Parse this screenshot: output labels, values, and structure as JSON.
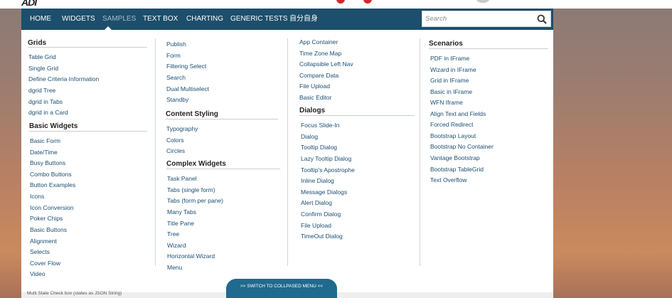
{
  "brand": {
    "logo_text": "ADI",
    "logo_accent": "#c0242a"
  },
  "nav": {
    "items": [
      "HOME",
      "WIDGETS",
      "SAMPLES",
      "TEXT BOX",
      "CHARTING",
      "GENERIC TESTS",
      "自分自身"
    ],
    "active": "SAMPLES"
  },
  "search": {
    "placeholder": "Search",
    "icon": "search-icon"
  },
  "col1": {
    "grids_heading": "Grids",
    "grids": [
      "Table Grid",
      "Single Grid",
      "Define Criteria Information",
      "dgrid Tree",
      "dgrid in Tabs",
      "dgrid in a Card"
    ],
    "basic_heading": "Basic Widgets",
    "basic": [
      "Basic Form",
      "Date/Time",
      "Busy Buttons",
      "Combo Buttons",
      "Button Examples",
      "Icons",
      "Icon Conversion",
      "Poker Chips",
      "Basic Buttons",
      "Alignment",
      "Selects",
      "Cover Flow",
      "Video"
    ]
  },
  "col2": {
    "top": [
      "Publish",
      "Form",
      "Filtering Select",
      "Search",
      "Dual Multiselect",
      "Standby"
    ],
    "content_heading": "Content Styling",
    "content": [
      "Typography",
      "Colors",
      "Circles"
    ],
    "complex_heading": "Complex Widgets",
    "complex": [
      "Task Panel",
      "Tabs (single form)",
      "Tabs (form per pane)",
      "Many Tabs",
      "Title Pane",
      "Tree",
      "Wizard",
      "Horizontal Wizard",
      "Menu"
    ]
  },
  "col3": {
    "top": [
      "App Container",
      "Time Zone Map",
      "Collapsible Left Nav",
      "Compare Data",
      "File Upload",
      "Basic Editor"
    ],
    "dialogs_heading": "Dialogs",
    "dialogs": [
      "Focus Slide-In",
      "Dialog",
      "Tooltip Dialog",
      "Lazy Tooltip Dialog",
      "Tooltip's Apostrophe",
      "Inline Dialog",
      "Message Dialogs",
      "Alert Dialog",
      "Confirm Dialog",
      "File Upload",
      "TimeOut Dialog"
    ]
  },
  "col4": {
    "scenarios_heading": "Scenarios",
    "scenarios": [
      "PDF in IFrame",
      "Wizard in IFrame",
      "Grid in IFrame",
      "Basic in IFrame",
      "WFN Iframe",
      "Align Text and Fields",
      "Forced Redirect",
      "Bootstrap Layout",
      "Bootstrap No Container",
      "Vantage Bootstrap",
      "Bootstrap TableGrid",
      "Text Overflow"
    ]
  },
  "switch_button": {
    "label": ">> SWITCH TO COLLPASED MENU <<"
  },
  "footer_text": "Multi State Check box (states as JSON String)",
  "colors": {
    "navbar": "#1d4e6b",
    "link": "#1a4f72",
    "switch_button": "#1f6a8e"
  }
}
